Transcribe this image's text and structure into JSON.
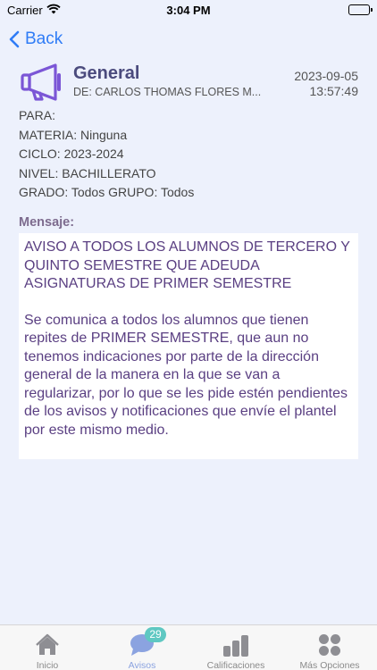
{
  "status_bar": {
    "carrier": "Carrier",
    "time": "3:04 PM"
  },
  "nav": {
    "back_label": "Back"
  },
  "notice": {
    "title": "General",
    "sender": "DE: CARLOS THOMAS FLORES M...",
    "date": "2023-09-05",
    "time": "13:57:49",
    "meta": {
      "para": "PARA:",
      "materia": "MATERIA: Ninguna",
      "ciclo": "CICLO: 2023-2024",
      "nivel": "NIVEL: BACHILLERATO",
      "grado": "GRADO: Todos GRUPO: Todos"
    },
    "message_label": "Mensaje:",
    "message_heading": "AVISO A TODOS LOS ALUMNOS DE TERCERO Y QUINTO SEMESTRE QUE ADEUDA ASIGNATURAS DE PRIMER SEMESTRE",
    "message_body": "Se comunica a todos los alumnos que tienen repites de PRIMER SEMESTRE, que aun no tenemos indicaciones por parte de la dirección general de la manera en la que se van a regularizar, por lo que se les pide estén pendientes de los avisos y notificaciones que envíe el plantel por este mismo medio."
  },
  "tabs": [
    {
      "label": "Inicio",
      "icon": "home-icon"
    },
    {
      "label": "Avisos",
      "icon": "chat-bubble-icon",
      "badge": "29",
      "active": true
    },
    {
      "label": "Calificaciones",
      "icon": "bar-chart-icon"
    },
    {
      "label": "Más Opciones",
      "icon": "grid-dots-icon"
    }
  ],
  "colors": {
    "background": "#EDF1FC",
    "accent_blue": "#2F7CF6",
    "title_purple": "#4B4B7D",
    "message_purple": "#5A3F82",
    "badge_teal": "#5FC8C2",
    "tab_active": "#8BA3E0"
  }
}
